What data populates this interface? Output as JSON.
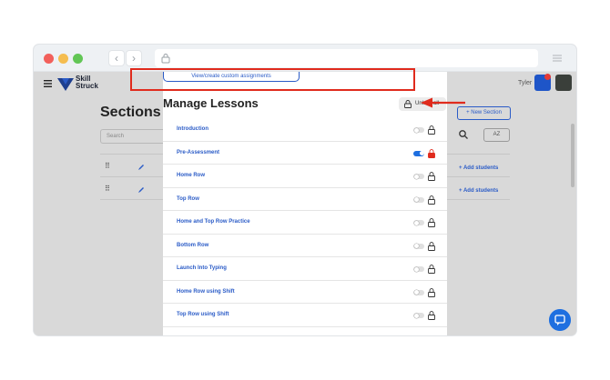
{
  "browser": {
    "back_glyph": "‹",
    "forward_glyph": "›"
  },
  "app": {
    "logo_text_line1": "Skill",
    "logo_text_line2": "Struck",
    "user_name": "Tyler"
  },
  "background_page": {
    "title": "Sections",
    "search_placeholder": "Search",
    "new_section_label": "+ New Section",
    "sort_label": "AZ",
    "add_students_label": "+ Add students"
  },
  "modal": {
    "custom_assignments_label": "View/create custom assignments",
    "title": "Manage Lessons",
    "unlock_all_label": "Unlock all",
    "lessons": [
      {
        "name": "Introduction",
        "unlocked": false
      },
      {
        "name": "Pre-Assessment",
        "unlocked": true
      },
      {
        "name": "Home Row",
        "unlocked": false
      },
      {
        "name": "Top Row",
        "unlocked": false
      },
      {
        "name": "Home and Top Row Practice",
        "unlocked": false
      },
      {
        "name": "Bottom Row",
        "unlocked": false
      },
      {
        "name": "Launch Into Typing",
        "unlocked": false
      },
      {
        "name": "Home Row using Shift",
        "unlocked": false
      },
      {
        "name": "Top Row using Shift",
        "unlocked": false
      }
    ]
  },
  "colors": {
    "accent": "#2a5bc7",
    "toggle_on": "#1e6fe0",
    "highlight": "#e02b1d",
    "lock_unlocked": "#333333"
  }
}
